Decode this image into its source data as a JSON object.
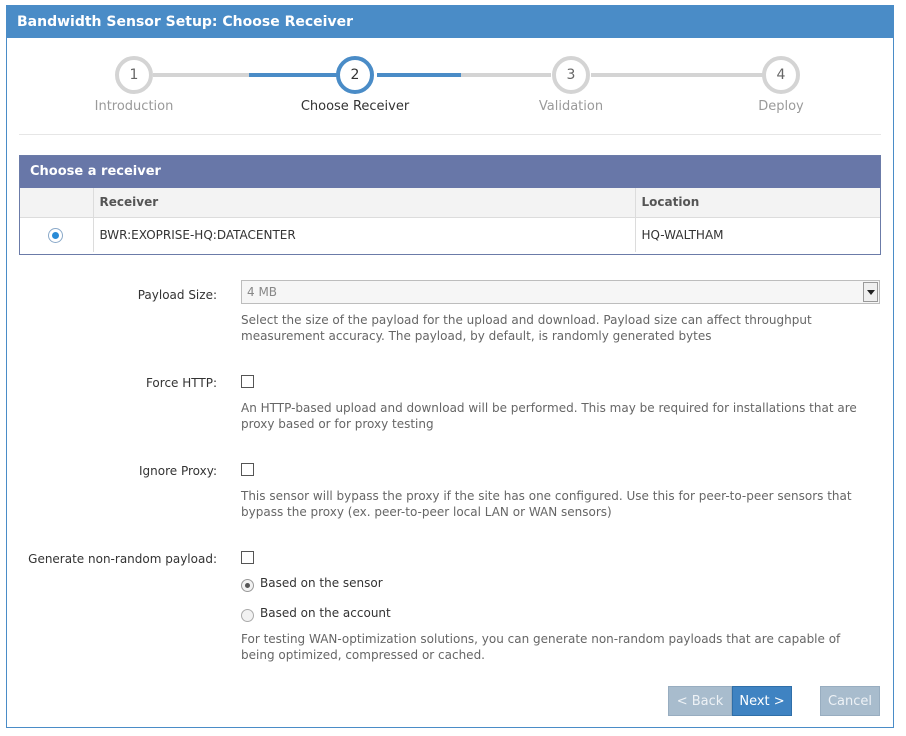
{
  "window": {
    "title": "Bandwidth Sensor Setup: Choose Receiver"
  },
  "wizard": {
    "steps": [
      {
        "number": "1",
        "label": "Introduction"
      },
      {
        "number": "2",
        "label": "Choose Receiver"
      },
      {
        "number": "3",
        "label": "Validation"
      },
      {
        "number": "4",
        "label": "Deploy"
      }
    ],
    "active_step": 2
  },
  "receiver": {
    "header": "Choose a receiver",
    "columns": [
      "Receiver",
      "Location"
    ],
    "rows": [
      {
        "selected": true,
        "receiver": "BWR:EXOPRISE-HQ:DATACENTER",
        "location": "HQ-WALTHAM"
      }
    ]
  },
  "form": {
    "payload_size": {
      "label": "Payload Size:",
      "value": "4 MB",
      "help": "Select the size of the payload for the upload and download. Payload size can affect throughput measurement accuracy. The payload, by default, is randomly generated bytes"
    },
    "force_http": {
      "label": "Force HTTP:",
      "checked": false,
      "help": "An HTTP-based upload and download will be performed. This may be required for installations that are proxy based or for proxy testing"
    },
    "ignore_proxy": {
      "label": "Ignore Proxy:",
      "checked": false,
      "help": "This sensor will bypass the proxy if the site has one configured. Use this for peer-to-peer sensors that bypass the proxy (ex. peer-to-peer local LAN or WAN sensors)"
    },
    "non_random": {
      "label": "Generate non-random payload:",
      "checked": false,
      "option_sensor": "Based on the sensor",
      "option_account": "Based on the account",
      "selected_option": "Based on the sensor",
      "help": "For testing WAN-optimization solutions, you can generate non-random payloads that are capable of being optimized, compressed or cached."
    }
  },
  "buttons": {
    "back": "< Back",
    "next": "Next >",
    "cancel": "Cancel"
  },
  "colors": {
    "accent": "#4a8cc7",
    "table_header": "#6877a8",
    "primary_button": "#3f83c2",
    "disabled_button": "#a8bccd"
  }
}
